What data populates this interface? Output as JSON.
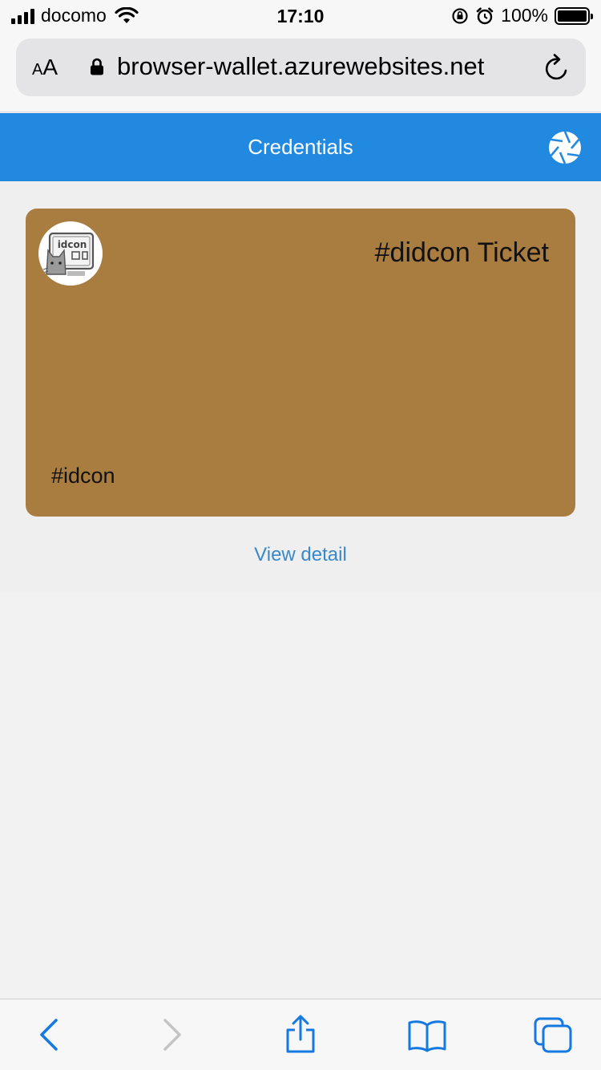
{
  "status_bar": {
    "carrier": "docomo",
    "time": "17:10",
    "battery": "100%"
  },
  "browser": {
    "text_size_label": "AA",
    "url": "browser-wallet.azurewebsites.net"
  },
  "header": {
    "title": "Credentials"
  },
  "card": {
    "title": "#didcon Ticket",
    "issuer": "#idcon",
    "color": "#a97c40",
    "logo_text": "idcon"
  },
  "actions": {
    "view_detail": "View detail"
  },
  "colors": {
    "header": "#2289e1",
    "link": "#3a87c9",
    "ios_blue": "#1479e0"
  }
}
